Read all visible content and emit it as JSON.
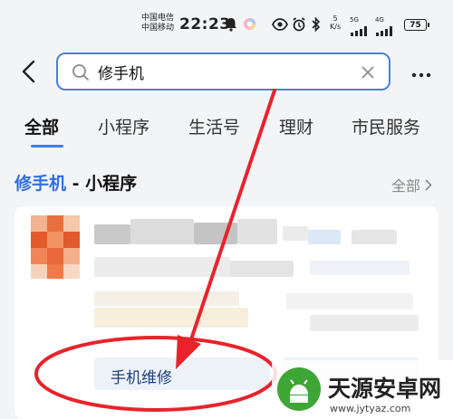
{
  "status_bar": {
    "carrier_1": "中国电信",
    "carrier_2": "中国移动",
    "time": "22:23",
    "net_speed_value": "5",
    "net_speed_unit": "K/s",
    "signal_1": "5G",
    "signal_2": "4G",
    "battery": "75",
    "icons": [
      "bell-icon",
      "color-wheel-icon",
      "eye-icon",
      "alarm-icon",
      "bluetooth-icon"
    ]
  },
  "search": {
    "query": "修手机",
    "icons": [
      "back-arrow-icon",
      "search-icon",
      "clear-icon",
      "more-icon"
    ]
  },
  "tabs": [
    {
      "label": "全部",
      "active": true
    },
    {
      "label": "小程序",
      "active": false
    },
    {
      "label": "生活号",
      "active": false
    },
    {
      "label": "理财",
      "active": false
    },
    {
      "label": "市民服务",
      "active": false
    }
  ],
  "section": {
    "keyword": "修手机",
    "separator": " - ",
    "category": "小程序",
    "all_link": "全部",
    "all_icon": "chevron-right-icon"
  },
  "result": {
    "service_chip": "手机维修"
  },
  "colors": {
    "accent": "#3d7ef2",
    "annotation": "#e8232b",
    "background": "#f3f4f6"
  },
  "watermark": {
    "name": "天源安卓网",
    "url": "www.jytyaz.com"
  }
}
